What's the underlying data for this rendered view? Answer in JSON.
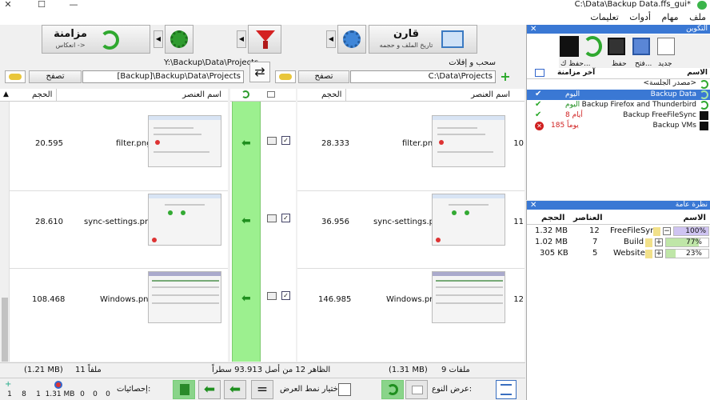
{
  "window": {
    "title": "C:\\Data\\Backup Data.ffs_gui*"
  },
  "menu": [
    "ملف",
    "مهام",
    "أدوات",
    "تعليمات"
  ],
  "toolbar": {
    "compare_label": "قارن",
    "compare_sub": "تاريخ الملف و حجمه",
    "sync_label": "مزامنة",
    "sync_sub": "انعكاس ->"
  },
  "paths": {
    "left_path": "C:\\Data\\Projects",
    "right_path": "[Backup]\\Backup\\Data\\Projects",
    "right_header_path": "Y:\\Backup\\Data\\Projects",
    "drag_label": "سحب و إفلات",
    "browse_label": "تصفح"
  },
  "grid": {
    "name_header": "اسم العنصر",
    "size_header": "الحجم",
    "rows": [
      {
        "num": "10",
        "left_name": "filter.png",
        "left_size": "28.333",
        "right_name": "filter.png",
        "right_size": "20.595"
      },
      {
        "num": "11",
        "left_name": "sync-settings.png",
        "left_size": "36.956",
        "right_name": "sync-settings.png",
        "right_size": "28.610"
      },
      {
        "num": "12",
        "left_name": "Windows.png",
        "left_size": "146.985",
        "right_name": "Windows.png",
        "right_size": "108.468"
      }
    ]
  },
  "config_panel": {
    "title": "التكوين",
    "buttons": {
      "new": "جديد",
      "open": "فتح...",
      "save": "حفظ",
      "save_as": "حفظ ك..."
    },
    "col_name": "الاسم",
    "col_last": "آخر مزامنة",
    "session": "<مصدر الجلسة>",
    "items": [
      {
        "name": "Backup Data",
        "last": "اليوم",
        "status": "ok",
        "selected": true
      },
      {
        "name": "Backup Firefox and Thunderbird",
        "last": "اليوم",
        "status": "ok",
        "selected": false
      },
      {
        "name": "Backup FreeFileSync",
        "last": "8 أيام",
        "status": "ok",
        "selected": false
      },
      {
        "name": "Backup VMs",
        "last": "185 يوماً",
        "status": "error",
        "selected": false
      }
    ]
  },
  "overview_panel": {
    "title": "نظرة عامة",
    "col_name": "الاسم",
    "col_items": "العناصر",
    "col_size": "الحجم",
    "rows": [
      {
        "name": "FreeFileSync",
        "items": "12",
        "size": "1.32 MB",
        "percent": "100%",
        "fill": 1.0,
        "toggle": "−"
      },
      {
        "name": "Build",
        "items": "7",
        "size": "1.02 MB",
        "percent": "77%",
        "fill": 0.77,
        "toggle": "+"
      },
      {
        "name": "Website",
        "items": "5",
        "size": "305 KB",
        "percent": "23%",
        "fill": 0.23,
        "toggle": "+"
      }
    ]
  },
  "status": {
    "left_files": "9 ملفات",
    "left_size": "(1.31 MB)",
    "center": "الظاهر 12 من أصل 93.913 سطراً",
    "right_files": "11 ملفاً",
    "right_size": "(1.21 MB)"
  },
  "bottom": {
    "view_type": "عرض النوع:",
    "view_mode": "اختيار نمط العرض:",
    "stats_label": "إحصائيات:",
    "stats": [
      "0",
      "0",
      "0",
      "1.31 MB",
      "1",
      "8",
      "1"
    ]
  }
}
